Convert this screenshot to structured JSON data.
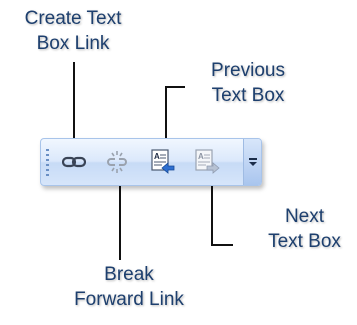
{
  "callouts": {
    "create_text_box_link": [
      "Create Text",
      "Box Link"
    ],
    "previous_text_box": [
      "Previous",
      "Text Box"
    ],
    "next_text_box": [
      "Next",
      "Text Box"
    ],
    "break_forward_link": [
      "Break",
      "Forward Link"
    ]
  },
  "toolbar": {
    "buttons": [
      {
        "name": "create-text-box-link",
        "icon": "link-icon",
        "enabled": true
      },
      {
        "name": "break-forward-link",
        "icon": "broken-link-icon",
        "enabled": false
      },
      {
        "name": "previous-text-box",
        "icon": "previous-text-box-icon",
        "enabled": true
      },
      {
        "name": "next-text-box",
        "icon": "next-text-box-icon",
        "enabled": false
      }
    ],
    "overflow_icon": "toolbar-options-icon"
  },
  "colors": {
    "label_text": "#1d3f6e",
    "toolbar_light": "#f1f7ff",
    "toolbar_dark": "#c7dbf6",
    "toolbar_border": "#a8c4ea",
    "accent_blue": "#2e6fd0"
  }
}
